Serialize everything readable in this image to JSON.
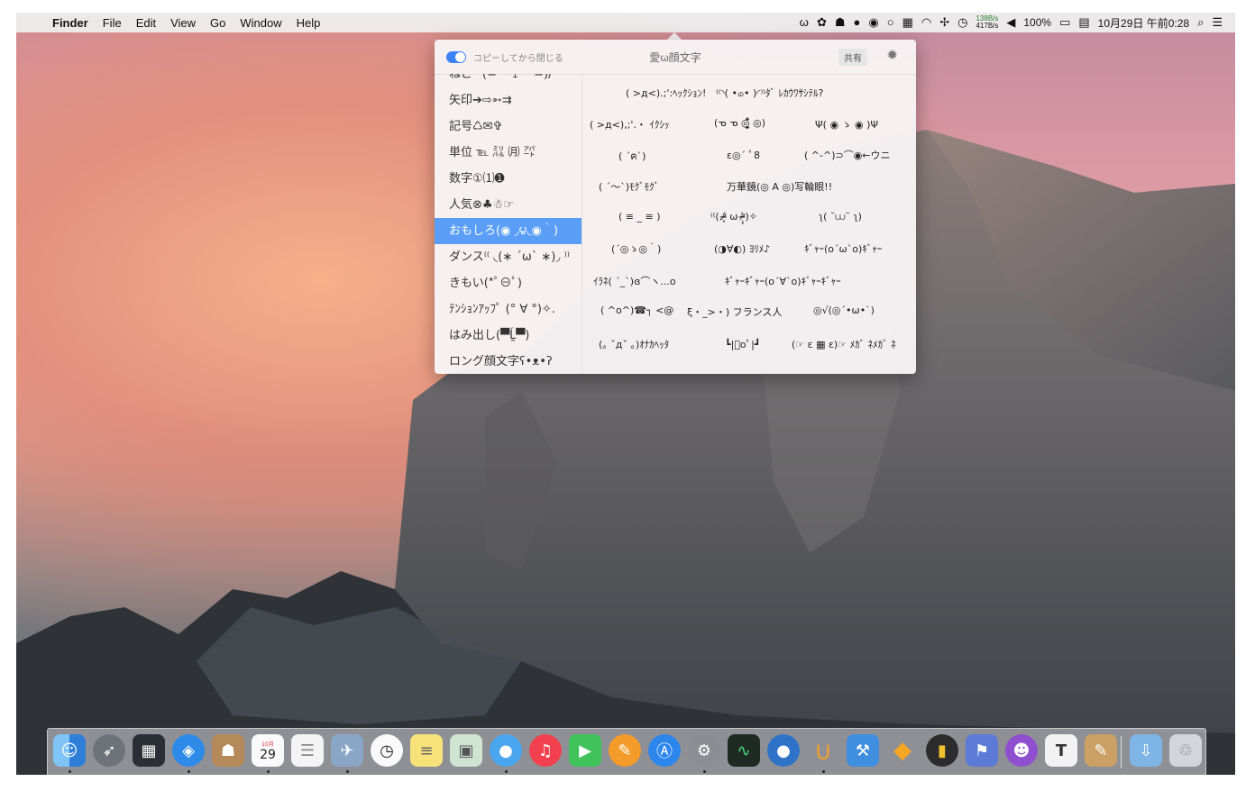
{
  "menubar": {
    "apple": "",
    "app_name": "Finder",
    "menus": [
      "File",
      "Edit",
      "View",
      "Go",
      "Window",
      "Help"
    ],
    "status": {
      "omega": "ω",
      "net_up": "138B/s",
      "net_down": "417B/s",
      "battery": "100%",
      "datetime": "10月29日 午前0:28"
    }
  },
  "popup": {
    "toggle_label": "コピーしてから閉じる",
    "title": "愛ω顔文字",
    "share_label": "共有",
    "categories": [
      "ねこ^(=^･ｪ･^=)/",
      "矢印➔⇨➳⇉",
      "記号♺✉✞",
      "単位 ℡ ㍊ ㈪ ㌀",
      "数字①⑴➊",
      "人気⊗♣☃☞",
      "おもしろ(◉ ◞౪◟◉｀)",
      "ダンス⁽⁽ ◟(∗ ˊωˋ ∗)◞ ⁾⁾",
      "きもい(*ﾟ⊖ﾟ)",
      "ﾃﾝｼｮﾝｱｯﾌﾟ (° ∀ °)✧.",
      "はみ出し(▀̿Ĺ̯▀̿)",
      "ロング顔文字ʕ•ᴥ•ʔ"
    ],
    "active_category": 6,
    "faces": [
      "( >д<).;':ﾍｯｸｼｮﾝ!",
      "⁽⁽◝( •௰• )◜⁾⁾ﾀﾞ ﾚｶｳﾜｻｼﾃﾙ?",
      "( >д<),;'.・ ｲｸｼｯ",
      "(ᓀ ᓀ ◎̩̦̥̪̮̗͚̔̆̆̐̋ ◎)",
      "Ψ( ◉ ゝ ◉ )Ψ",
      "( ´ฅ`)",
      "ε◎´ ﾟ8",
      "( ^-^)⊃⌒◉←ウニ",
      "( ´〜`)ﾓｸﾞﾓｸﾞ",
      "万華鏡(◎ A ◎)写輪眼!!",
      "( ≡ _ ≡ )",
      "⁽⁽(.ᵒ̴̶̷̥́ ω ᵒ̴̶̷̣̥̀)✧",
      "ʅ( ˘⩊˘ ʅ)",
      "(´◎ゝ◎｀)",
      "(◑∀◐) ﾖﾘﾒ♪",
      "ｷﾞｬｰ(o´ω`o)ｷﾞｬｰ",
      "ｲﾗﾈ( ´_`)ɞ⌒ヽ...o",
      "ｷﾞｬｰｷﾞｬｰ(o´∀`o)ｷﾞｬｰｷﾞｬｰ",
      "( ^o^)☎┐ <@",
      "ξ・_>・) フランス人",
      "◎√(◎´•ω•`)",
      "(｡ ˇдˇ ｡)ｵﾅｶﾍｯﾀ",
      "┗|ﾟoﾟ|┛",
      "(☞ ε ▦ ε)☞ ﾒｶﾞ ﾈﾒｶﾞ ﾈ"
    ]
  },
  "dock": {
    "calendar_day": "29",
    "calendar_month": "10月",
    "icons": [
      "finder-icon",
      "launchpad-icon",
      "mission-control-icon",
      "safari-icon",
      "contacts-icon",
      "calendar-icon",
      "reminders-icon",
      "mail-icon",
      "clock-icon",
      "notes-icon",
      "preview-icon",
      "messages-icon",
      "music-icon",
      "facetime-icon",
      "books-icon",
      "app-store-icon",
      "system-preferences-icon",
      "activity-monitor-icon",
      "blue-circle-icon",
      "magnet-icon",
      "xcode-icon",
      "sketch-icon",
      "stocks-icon",
      "tool-icon",
      "github-icon",
      "text-icon",
      "photo-icon",
      "downloads-folder-icon",
      "trash-icon"
    ]
  }
}
